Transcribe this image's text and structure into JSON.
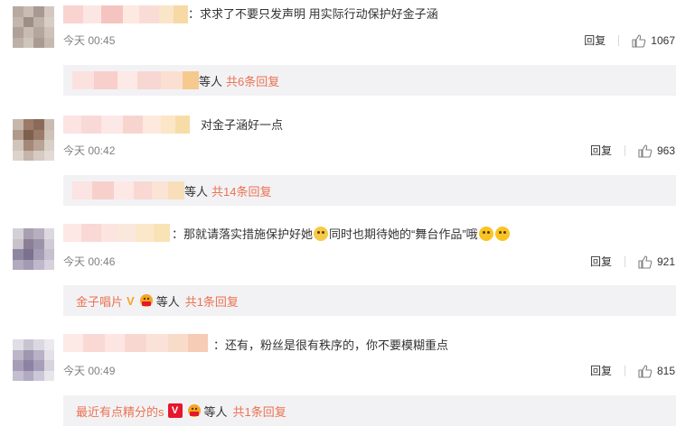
{
  "comments": [
    {
      "text": "：求求了不要只发声明 用实际行动保护好金子涵",
      "time": "今天 00:45",
      "reply_label": "回复",
      "likes": "1067",
      "reply_box": {
        "name": "",
        "others": "等人",
        "count_label": "共6条回复"
      }
    },
    {
      "text": "对金子涵好一点",
      "time": "今天 00:42",
      "reply_label": "回复",
      "likes": "963",
      "reply_box": {
        "name": "",
        "others": "等人",
        "count_label": "共14条回复"
      }
    },
    {
      "text_a": "：那就请落实措施保护好她",
      "text_b": "同时也期待她的“舞台作品”哦",
      "time": "今天 00:46",
      "reply_label": "回复",
      "likes": "921",
      "reply_box": {
        "name": "金子唱片",
        "vip": "V",
        "others": "等人",
        "count_label": "共1条回复"
      }
    },
    {
      "text": "：还有，粉丝是很有秩序的，你不要模糊重点",
      "time": "今天 00:49",
      "reply_label": "回复",
      "likes": "815",
      "reply_box": {
        "name": "最近有点精分的s",
        "vip": "V",
        "others": "等人",
        "count_label": "共1条回复"
      }
    }
  ],
  "icons": {
    "like": "thumbs-up-icon",
    "emoji_sad": "sad-face-emoji-icon",
    "emoji_laugh": "laughing-face-emoji-icon",
    "vip_badge": "vip-v-icon",
    "level_badge": "level-badge-icon"
  },
  "colors": {
    "accent": "#eb7350",
    "muted": "#808080",
    "reply_bg": "#f2f2f5",
    "vip_gold": "#f5a623",
    "vip_red": "#e6162d"
  }
}
